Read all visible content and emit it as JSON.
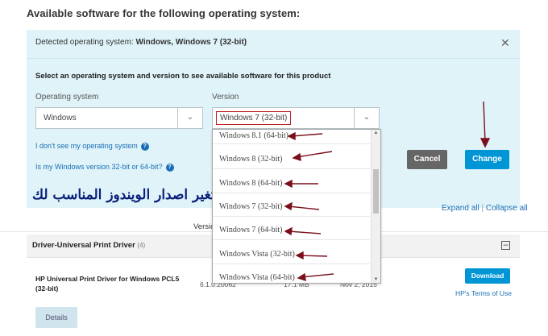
{
  "heading": "Available software for the following operating system:",
  "detected": {
    "prefix": "Detected operating system: ",
    "value": "Windows, Windows 7 (32-bit)"
  },
  "instruction": "Select an operating system and version to see available software for this product",
  "os_select": {
    "label": "Operating system",
    "value": "Windows"
  },
  "version_select": {
    "label": "Version",
    "value": "Windows 7 (32-bit)"
  },
  "links": {
    "not_see_os": "I don't see my operating system",
    "bitness": "Is my Windows version 32-bit or 64-bit?"
  },
  "buttons": {
    "cancel": "Cancel",
    "change": "Change",
    "download": "Download",
    "details": "Details"
  },
  "annotation_text": "تغير اصدار الويندوز المناسب لك",
  "expand_all": "Expand all",
  "collapse_all": "Collapse all",
  "table": {
    "version_header": "Versio"
  },
  "group": {
    "title": "Driver-Universal Print Driver",
    "count": "(4)"
  },
  "driver": {
    "name": "HP Universal Print Driver for Windows PCL5 (32-bit)",
    "version": "6.1.0.20062",
    "size": "17.1 MB",
    "date": "Nov 2, 2015",
    "terms": "HP's Terms of Use"
  },
  "dropdown_items": [
    "Windows 8.1 (64-bit)",
    "Windows 8 (32-bit)",
    "Windows 8 (64-bit)",
    "Windows 7 (32-bit)",
    "Windows 7 (64-bit)",
    "Windows Vista (32-bit)",
    "Windows Vista (64-bit)"
  ],
  "colors": {
    "panel": "#dff3f9",
    "accent": "#0096d6",
    "annotation": "#7a0f1a",
    "annotation_text": "#0a1f7a"
  },
  "icons": [
    "close-icon",
    "chevron-down-icon",
    "help-icon",
    "collapse-icon",
    "arrow-annotation-icon"
  ]
}
